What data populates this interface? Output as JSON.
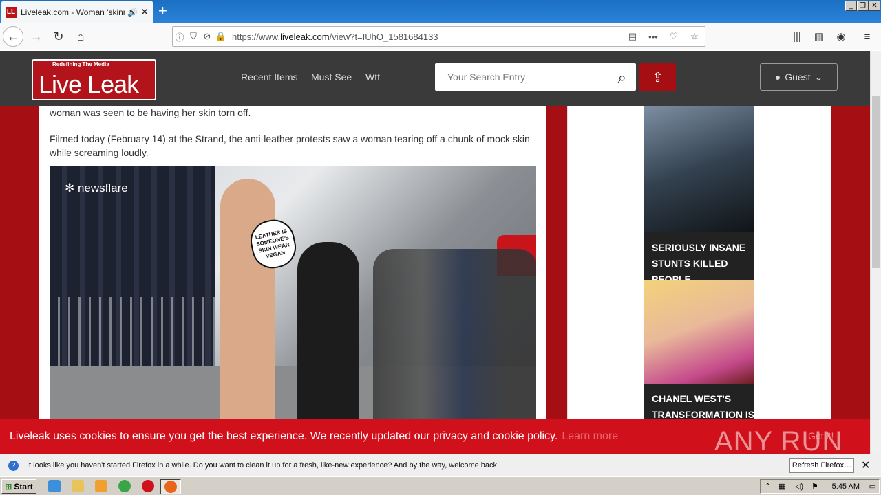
{
  "browser": {
    "tab_title": "Liveleak.com - Woman 'skinned",
    "tab_favicon": "LL",
    "url_domain": "liveleak.com",
    "url_prefix": "https://www.",
    "url_suffix": "/view?t=IUhO_1581684133"
  },
  "site": {
    "logo_tagline": "Redefining The Media",
    "logo_name": "Live Leak",
    "nav": [
      "Recent Items",
      "Must See",
      "Wtf"
    ],
    "search_placeholder": "Your Search Entry",
    "guest_label": "Guest",
    "brand_color": "#a50f14"
  },
  "article": {
    "para1": "woman was seen to be having her skin torn off.",
    "para2": "Filmed today (February 14) at the Strand, the anti-leather protests saw a woman tearing off a chunk of mock skin while screaming loudly.",
    "video_watermark": "newsflare",
    "sign_text": "LEATHER IS SOMEONE'S SKIN WEAR VEGAN"
  },
  "sidebar": {
    "cards": [
      {
        "caption": "SERIOUSLY INSANE STUNTS KILLED PEOPLE"
      },
      {
        "caption": "CHANEL WEST'S TRANSFORMATION IS"
      }
    ]
  },
  "cookie": {
    "text": "Liveleak uses cookies to ensure you get the best experience. We recently updated our privacy and cookie policy.",
    "learn_more": "Learn more",
    "got_it": "Got it!",
    "anyrun_watermark": "ANY RUN"
  },
  "notification": {
    "text": "It looks like you haven't started Firefox in a while. Do you want to clean it up for a fresh, like-new experience? And by the way, welcome back!",
    "refresh_button": "Refresh Firefox…"
  },
  "taskbar": {
    "start_label": "Start",
    "clock": "5:45 AM"
  }
}
